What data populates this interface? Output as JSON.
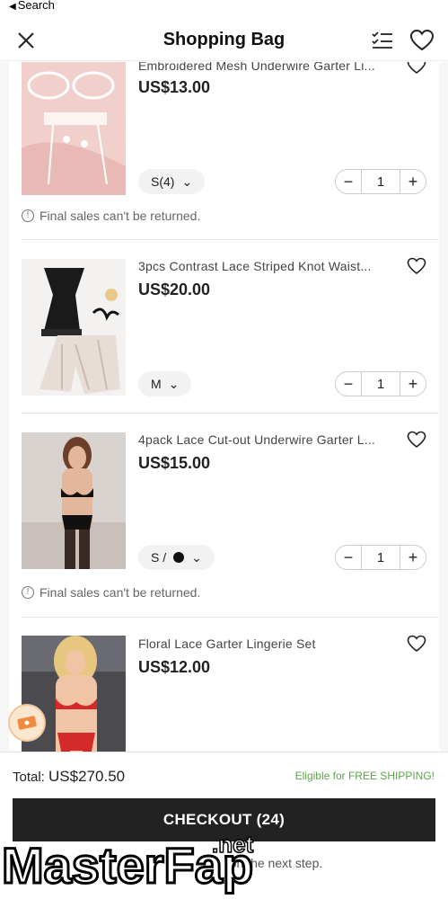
{
  "status_bar": {
    "back_label": "Search"
  },
  "header": {
    "title": "Shopping Bag"
  },
  "items": [
    {
      "name": "Embroidered Mesh Underwire Garter Li...",
      "price": "US$13.00",
      "size": "S(4)",
      "quantity": "1",
      "notice": "Final sales can't be returned."
    },
    {
      "name": "3pcs Contrast Lace Striped Knot Waist...",
      "price": "US$20.00",
      "size": "M",
      "quantity": "1"
    },
    {
      "name": "4pack Lace Cut-out Underwire Garter L...",
      "price": "US$15.00",
      "size": "S /",
      "quantity": "1",
      "notice": "Final sales can't be returned."
    },
    {
      "name": "Floral Lace Garter Lingerie Set",
      "price": "US$12.00"
    }
  ],
  "footer": {
    "total_label": "Total:",
    "total_value": "US$270.50",
    "shipping": "Eligible for FREE SHIPPING!",
    "checkout_label": "CHECKOUT (24)",
    "next_step_text": "on the next step."
  },
  "watermark": {
    "text": "MasterFap",
    "suffix": ".net"
  },
  "colors": {
    "accent_green": "#5aa64a",
    "checkout_bg": "#222222",
    "list_bg": "#f6f6f6"
  }
}
